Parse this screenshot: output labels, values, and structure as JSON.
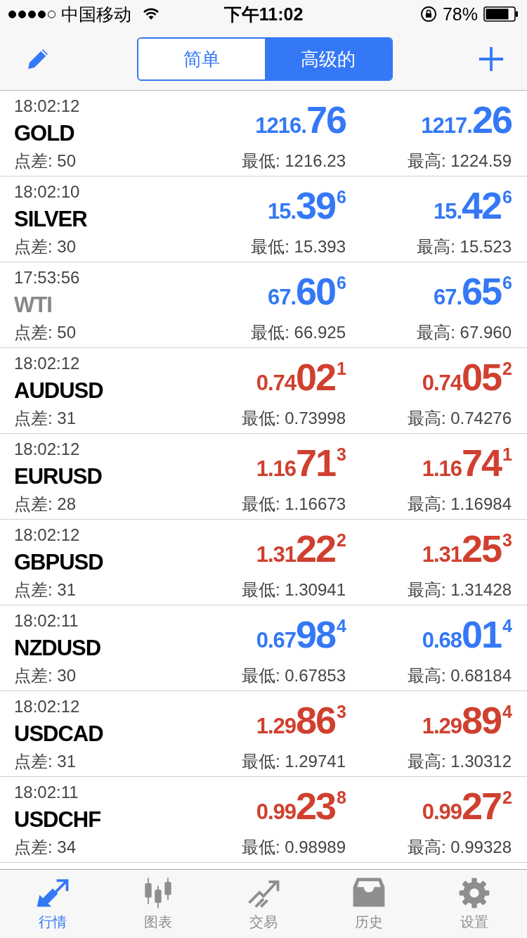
{
  "status_bar": {
    "carrier": "中国移动",
    "time": "下午11:02",
    "battery": "78%"
  },
  "segments": [
    {
      "label": "简单",
      "selected": false
    },
    {
      "label": "高级的",
      "selected": true
    }
  ],
  "quotes": [
    {
      "time": "18:02:12",
      "symbol": "GOLD",
      "inactive": false,
      "spread": "点差: 50",
      "color": "#3478f6",
      "bid": {
        "prefix": "1216.",
        "big": "76"
      },
      "ask": {
        "prefix": "1217.",
        "big": "26"
      },
      "low": "最低: 1216.23",
      "high": "最高: 1224.59"
    },
    {
      "time": "18:02:10",
      "symbol": "SILVER",
      "inactive": false,
      "spread": "点差: 30",
      "color": "#3478f6",
      "bid": {
        "prefix": "15.",
        "big": "39",
        "sup": "6"
      },
      "ask": {
        "prefix": "15.",
        "big": "42",
        "sup": "6"
      },
      "low": "最低: 15.393",
      "high": "最高: 15.523"
    },
    {
      "time": "17:53:56",
      "symbol": "WTI",
      "inactive": true,
      "spread": "点差: 50",
      "color": "#3478f6",
      "bid": {
        "prefix": "67.",
        "big": "60",
        "sup": "6"
      },
      "ask": {
        "prefix": "67.",
        "big": "65",
        "sup": "6"
      },
      "low": "最低: 66.925",
      "high": "最高: 67.960"
    },
    {
      "time": "18:02:12",
      "symbol": "AUDUSD",
      "inactive": false,
      "spread": "点差: 31",
      "color": "#d0402f",
      "bid": {
        "prefix": "0.74",
        "big": "02",
        "sup": "1"
      },
      "ask": {
        "prefix": "0.74",
        "big": "05",
        "sup": "2"
      },
      "low": "最低: 0.73998",
      "high": "最高: 0.74276"
    },
    {
      "time": "18:02:12",
      "symbol": "EURUSD",
      "inactive": false,
      "spread": "点差: 28",
      "color": "#d0402f",
      "bid": {
        "prefix": "1.16",
        "big": "71",
        "sup": "3"
      },
      "ask": {
        "prefix": "1.16",
        "big": "74",
        "sup": "1"
      },
      "low": "最低: 1.16673",
      "high": "最高: 1.16984"
    },
    {
      "time": "18:02:12",
      "symbol": "GBPUSD",
      "inactive": false,
      "spread": "点差: 31",
      "color": "#d0402f",
      "bid": {
        "prefix": "1.31",
        "big": "22",
        "sup": "2"
      },
      "ask": {
        "prefix": "1.31",
        "big": "25",
        "sup": "3"
      },
      "low": "最低: 1.30941",
      "high": "最高: 1.31428"
    },
    {
      "time": "18:02:11",
      "symbol": "NZDUSD",
      "inactive": false,
      "spread": "点差: 30",
      "color": "#3478f6",
      "bid": {
        "prefix": "0.67",
        "big": "98",
        "sup": "4"
      },
      "ask": {
        "prefix": "0.68",
        "big": "01",
        "sup": "4"
      },
      "low": "最低: 0.67853",
      "high": "最高: 0.68184"
    },
    {
      "time": "18:02:12",
      "symbol": "USDCAD",
      "inactive": false,
      "spread": "点差: 31",
      "color": "#d0402f",
      "bid": {
        "prefix": "1.29",
        "big": "86",
        "sup": "3"
      },
      "ask": {
        "prefix": "1.29",
        "big": "89",
        "sup": "4"
      },
      "low": "最低: 1.29741",
      "high": "最高: 1.30312"
    },
    {
      "time": "18:02:11",
      "symbol": "USDCHF",
      "inactive": false,
      "spread": "点差: 34",
      "color": "#d0402f",
      "bid": {
        "prefix": "0.99",
        "big": "23",
        "sup": "8"
      },
      "ask": {
        "prefix": "0.99",
        "big": "27",
        "sup": "2"
      },
      "low": "最低: 0.98989",
      "high": "最高: 0.99328"
    }
  ],
  "tab_bar": [
    {
      "kind": "quotes",
      "label": "行情",
      "selected": true
    },
    {
      "kind": "chart",
      "label": "图表",
      "selected": false
    },
    {
      "kind": "trade",
      "label": "交易",
      "selected": false
    },
    {
      "kind": "history",
      "label": "历史",
      "selected": false
    },
    {
      "kind": "settings",
      "label": "设置",
      "selected": false
    }
  ]
}
